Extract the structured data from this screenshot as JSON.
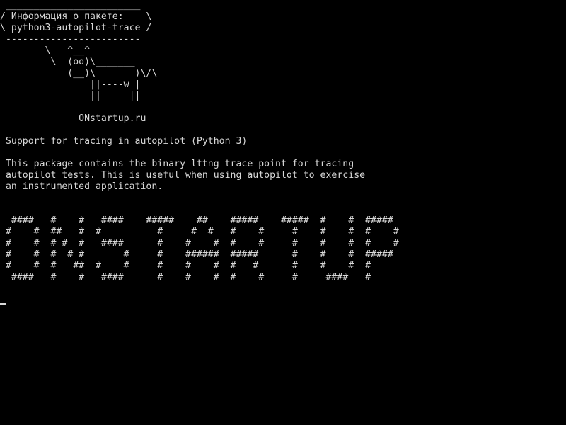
{
  "terminal": {
    "cowsay": " ________________________\n/ Информация о пакете:    \\\n\\ python3-autopilot-trace /\n ------------------------\n        \\   ^__^\n         \\  (oo)\\_______\n            (__)\\       )\\/\\\n                ||----w |\n                ||     ||",
    "site": "              ONstartup.ru",
    "summary": " Support for tracing in autopilot (Python 3)",
    "description": " This package contains the binary lttng trace point for tracing\n autopilot tests. This is useful when using autopilot to exercise\n an instrumented application.",
    "banner": "  ####   #    #   ####    #####    ##    #####    #####  #    #  #####\n #    #  ##   #  #          #     #  #   #    #     #    #    #  #    #\n #    #  # #  #   ####      #    #    #  #    #     #    #    #  #    #\n #    #  #  # #       #     #    ######  #####      #    #    #  #####\n #    #  #   ##  #    #     #    #    #  #   #      #    #    #  #\n  ####   #    #   ####      #    #    #  #    #     #     ####   #"
  }
}
